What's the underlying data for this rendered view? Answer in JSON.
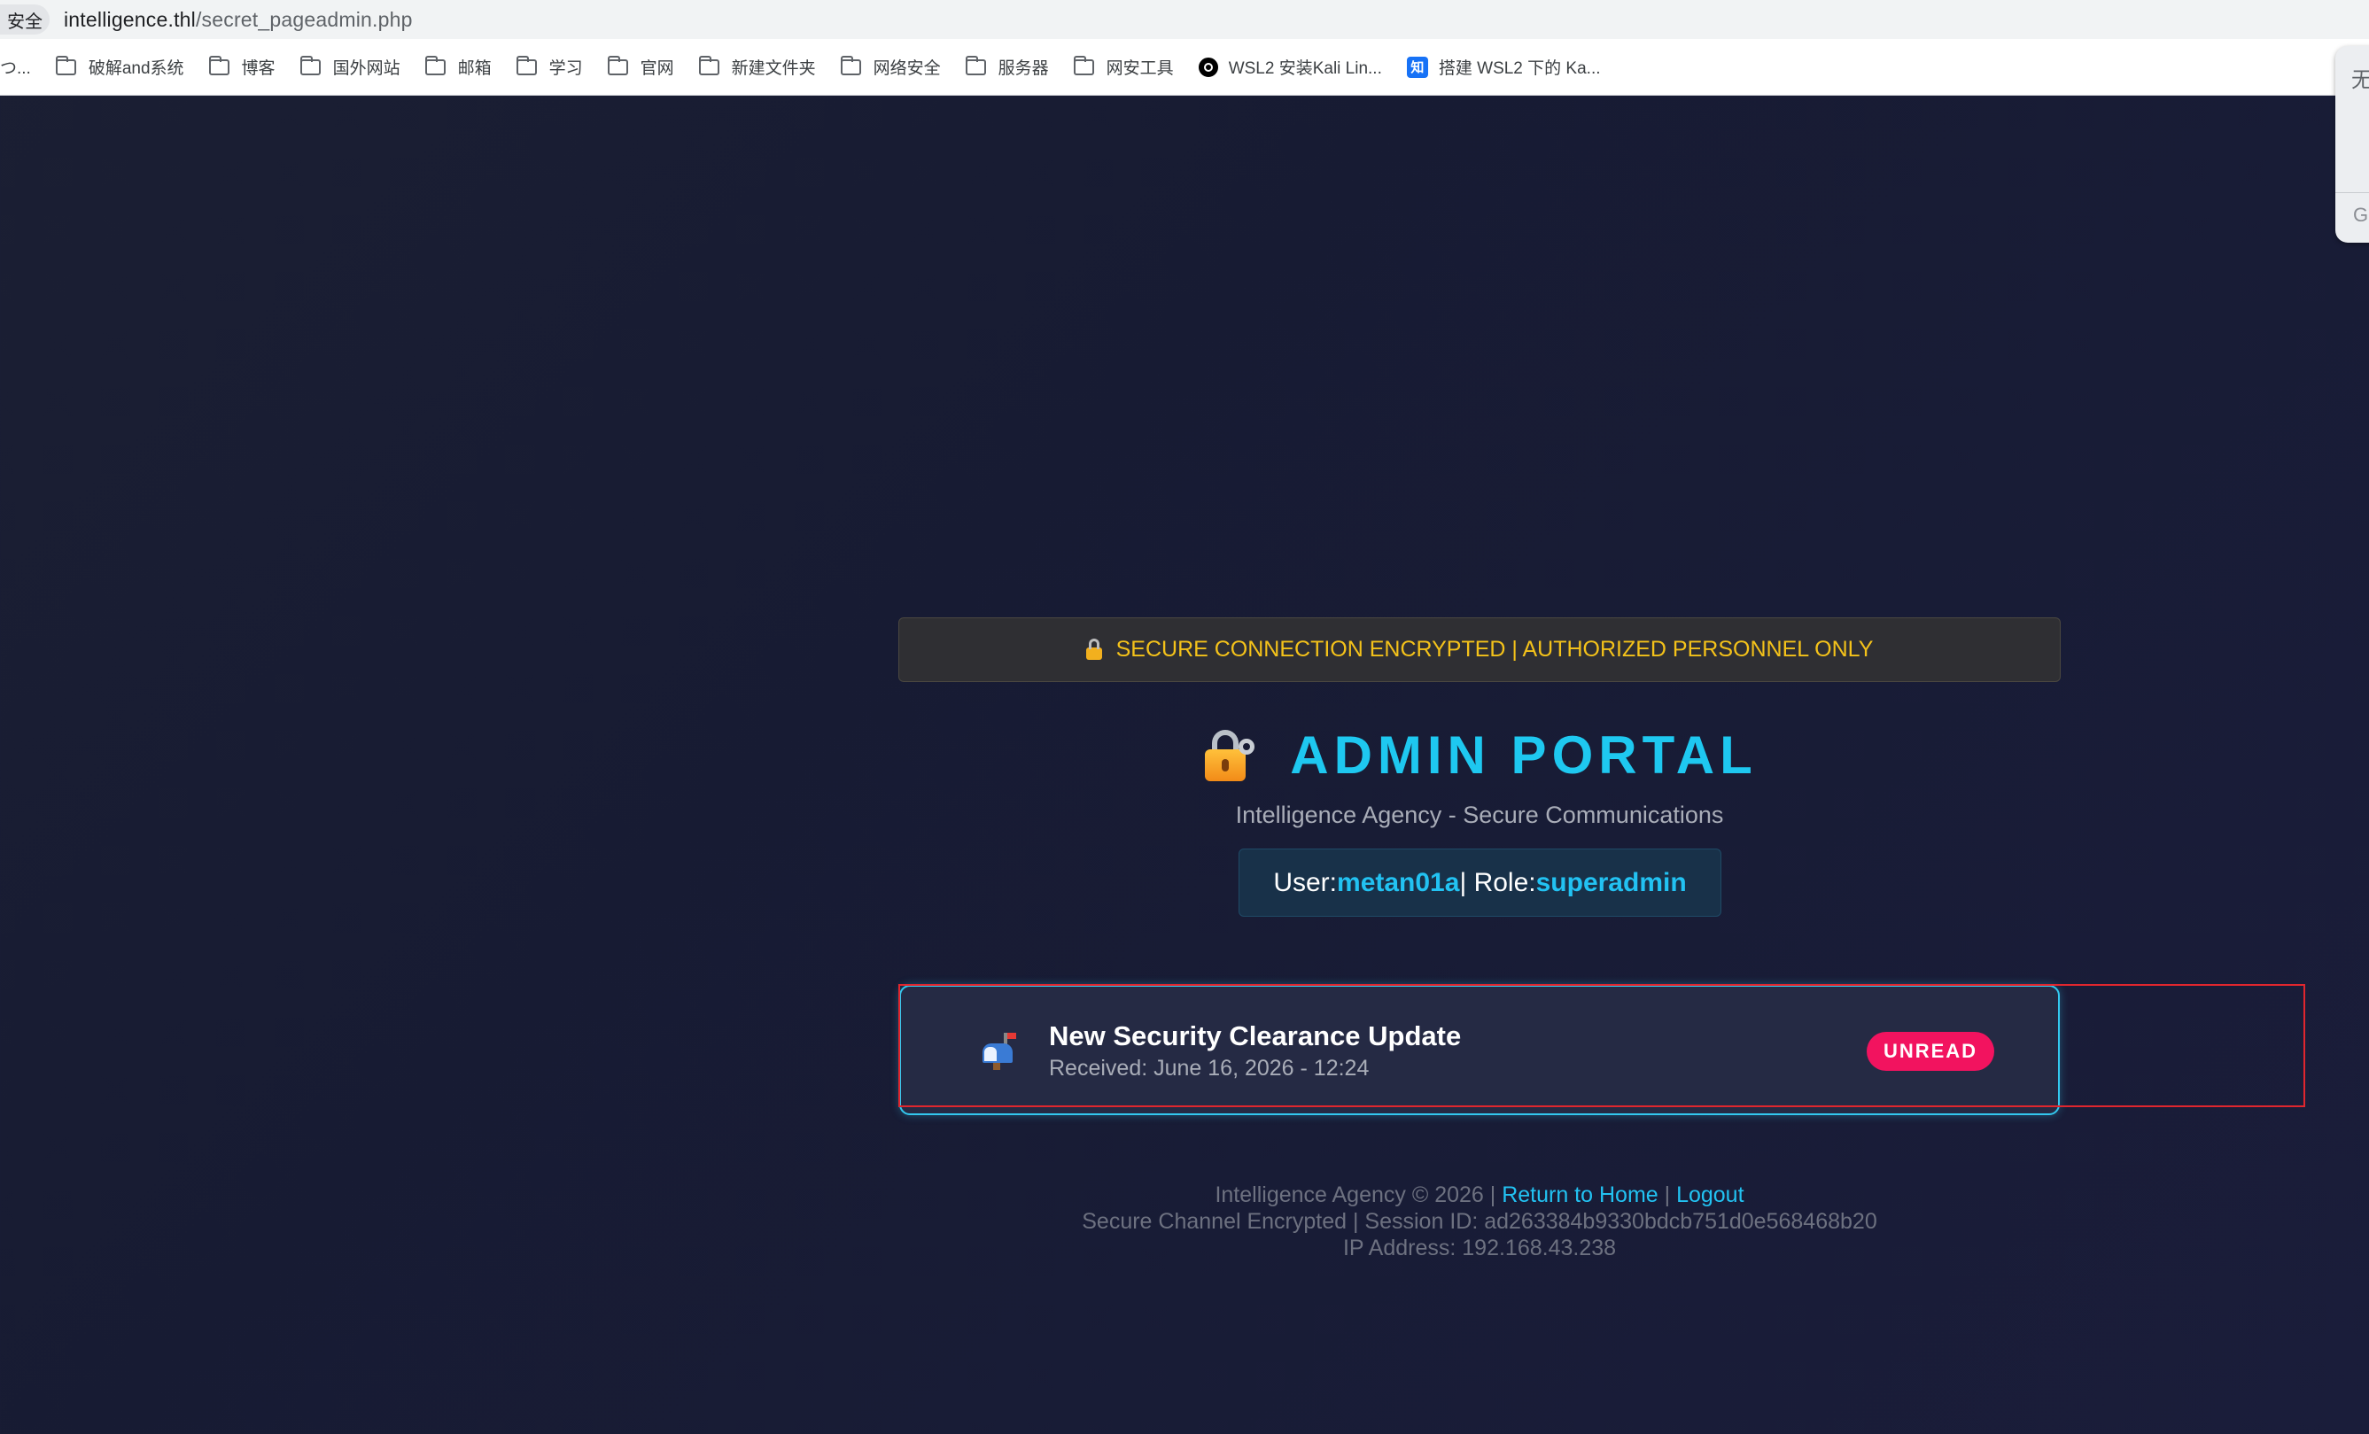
{
  "browser": {
    "secure_label": "安全",
    "url_host": "intelligence.thl",
    "url_path": "/secret_pageadmin.php"
  },
  "bookmarks": {
    "first": "つ...",
    "items": [
      {
        "label": "破解and系统",
        "icon": "folder-icon"
      },
      {
        "label": "博客",
        "icon": "folder-icon"
      },
      {
        "label": "国外网站",
        "icon": "folder-icon"
      },
      {
        "label": "邮箱",
        "icon": "folder-icon"
      },
      {
        "label": "学习",
        "icon": "folder-icon"
      },
      {
        "label": "官网",
        "icon": "folder-icon"
      },
      {
        "label": "新建文件夹",
        "icon": "folder-icon"
      },
      {
        "label": "网络安全",
        "icon": "folder-icon"
      },
      {
        "label": "服务器",
        "icon": "folder-icon"
      },
      {
        "label": "网安工具",
        "icon": "folder-icon"
      },
      {
        "label": "WSL2 安装Kali Lin...",
        "icon": "github-icon"
      },
      {
        "label": "搭建 WSL2 下的 Ka...",
        "icon": "zhihu-icon"
      }
    ],
    "zhihu_glyph": "知"
  },
  "side_panel": {
    "glyph_top": "无",
    "glyph_bottom": "G"
  },
  "page": {
    "banner": "SECURE CONNECTION ENCRYPTED | AUTHORIZED PERSONNEL ONLY",
    "title": "ADMIN PORTAL",
    "subtitle": "Intelligence Agency - Secure Communications",
    "user_label": "User: ",
    "user_name": "metan01a",
    "role_label": " | Role: ",
    "role_name": "superadmin"
  },
  "message": {
    "title": "New Security Clearance Update",
    "received": "Received: June 16, 2026 - 12:24",
    "badge": "UNREAD"
  },
  "footer": {
    "copyright": "Intelligence Agency © 2026 | ",
    "home_link": "Return to Home",
    "sep": " | ",
    "logout_link": "Logout",
    "session": "Secure Channel Encrypted | Session ID: ad263384b9330bdcb751d0e568468b20",
    "ip": "IP Address: 192.168.43.238"
  },
  "colors": {
    "background": "#171b33",
    "accent": "#22c2f2",
    "banner_text": "#f4c21a",
    "badge": "#f2135f",
    "highlight_box": "#e0262e"
  }
}
